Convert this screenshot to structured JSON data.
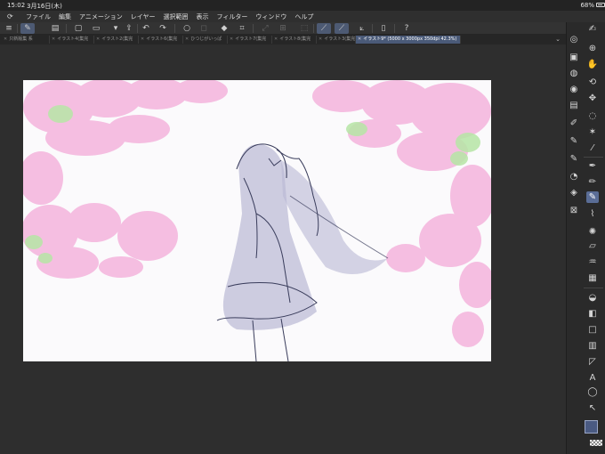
{
  "status": {
    "time": "15:02",
    "date": "3月16日(木)",
    "battery": "68%"
  },
  "menu": [
    "ファイル",
    "編集",
    "アニメーション",
    "レイヤー",
    "選択範囲",
    "表示",
    "フィルター",
    "ウィンドウ",
    "ヘルプ"
  ],
  "tabs": [
    {
      "label": "只新版集 系",
      "active": false
    },
    {
      "label": "イラスト4(集完",
      "active": false
    },
    {
      "label": "イラスト2(集完",
      "active": false
    },
    {
      "label": "イラスト6(集完",
      "active": false
    },
    {
      "label": "ひつじがいっぱ",
      "active": false
    },
    {
      "label": "イラスト7(集完",
      "active": false
    },
    {
      "label": "イラスト8(集完",
      "active": false
    },
    {
      "label": "イラスト3(集完",
      "active": false
    },
    {
      "label": "イラスト9* (5000 x 3000px 350dpi 42.3%)",
      "active": true
    }
  ],
  "icons": {
    "status_battery": "battery-icon",
    "menu_logo": "app-logo-icon",
    "tab_overflow": "chevron-down-icon"
  },
  "colors": {
    "accent": "#5a6d96",
    "active_tab": "#4a5a78",
    "main_color": "#4a5a82",
    "sub_color": "#e9e9e9",
    "canvas": "#fbfafc",
    "foliage_pink": "#f2a9d6",
    "foliage_green": "#b6e6a6",
    "sketch": "#3a3d5c"
  }
}
